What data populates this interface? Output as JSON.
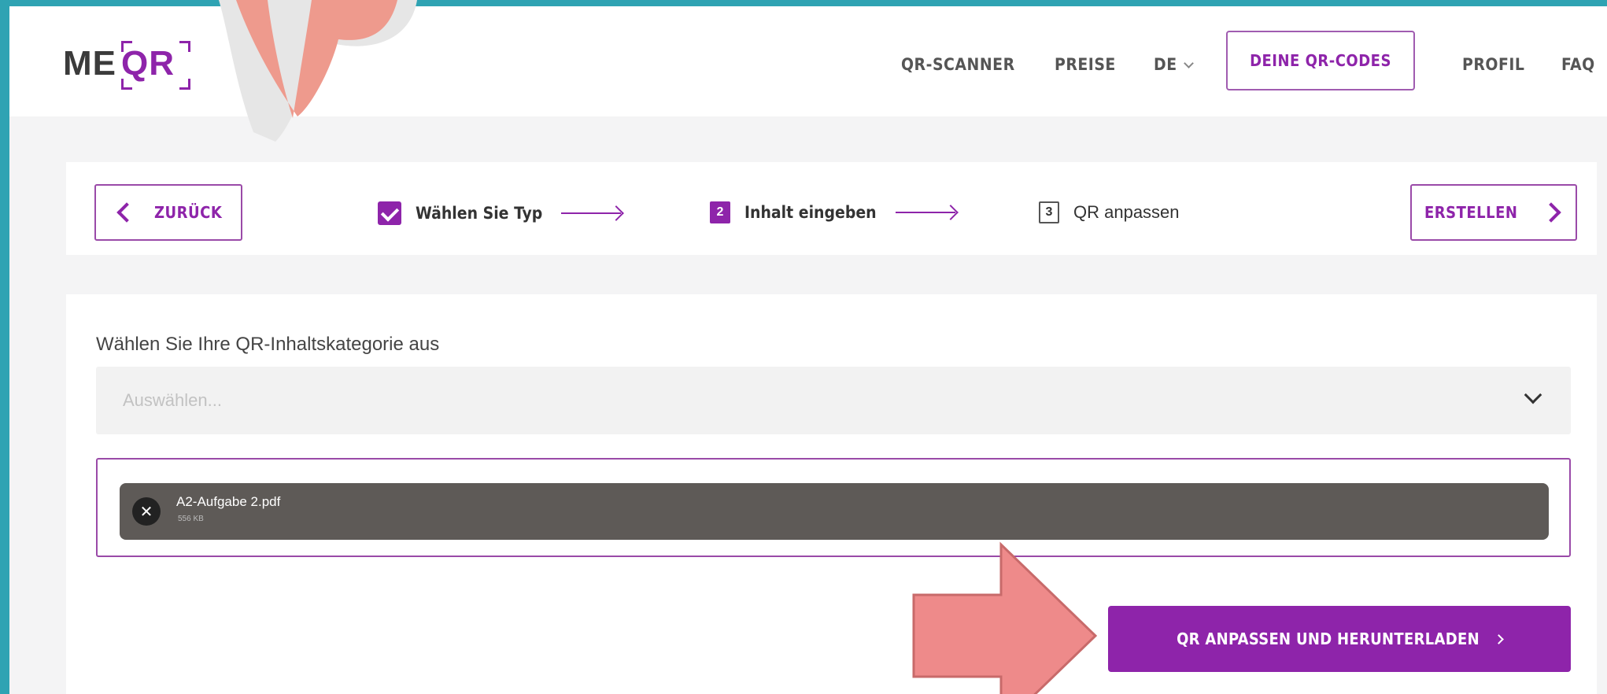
{
  "brand": {
    "logo_left": "ME",
    "logo_right": "QR"
  },
  "nav": {
    "qr_scanner": "QR-SCANNER",
    "pricing": "PREISE",
    "language": "DE",
    "my_codes": "DEINE QR-CODES",
    "profile": "PROFIL",
    "faq": "FAQ"
  },
  "stepper": {
    "back_label": "ZURÜCK",
    "create_label": "ERSTELLEN",
    "steps": [
      {
        "label": "Wählen Sie Typ",
        "status": "done"
      },
      {
        "number": "2",
        "label": "Inhalt eingeben",
        "status": "active"
      },
      {
        "number": "3",
        "label": "QR anpassen",
        "status": "pending"
      }
    ]
  },
  "content": {
    "category_label": "Wählen Sie Ihre QR-Inhaltskategorie aus",
    "category_placeholder": "Auswählen...",
    "file": {
      "name": "A2-Aufgabe 2.pdf",
      "size": "556 KB"
    },
    "submit_label": "QR ANPASSEN UND HERUNTERLADEN"
  },
  "colors": {
    "accent": "#8e24aa",
    "frame": "#2fa3b3",
    "annotation_arrow": "#ee8a8a",
    "file_chip": "#5e5a57"
  }
}
